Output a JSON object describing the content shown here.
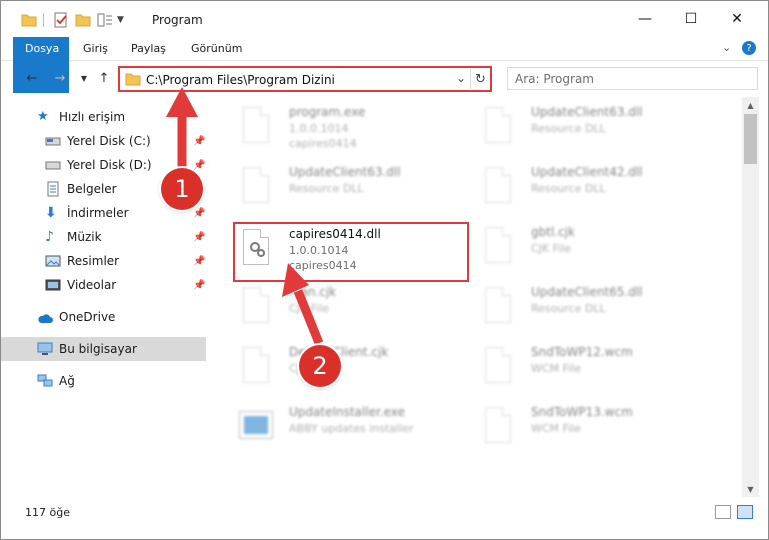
{
  "window": {
    "title": "Program",
    "buttons": {
      "minimize": "—",
      "maximize": "☐",
      "close": "✕"
    }
  },
  "ribbon": {
    "tabs": [
      "Dosya",
      "Giriş",
      "Paylaş",
      "Görünüm"
    ]
  },
  "address": {
    "path": "C:\\Program Files\\Program Dizini",
    "search_placeholder": "Ara: Program"
  },
  "nav_pane": {
    "items": [
      {
        "label": "Hızlı erişim",
        "icon": "star-icon",
        "pinned": false
      },
      {
        "label": "Yerel Disk (C:)",
        "icon": "drive-icon",
        "pinned": true
      },
      {
        "label": "Yerel Disk (D:)",
        "icon": "drive-icon",
        "pinned": true
      },
      {
        "label": "Belgeler",
        "icon": "documents-icon",
        "pinned": true
      },
      {
        "label": "İndirmeler",
        "icon": "download-icon",
        "pinned": true
      },
      {
        "label": "Müzik",
        "icon": "music-icon",
        "pinned": true
      },
      {
        "label": "Resimler",
        "icon": "pictures-icon",
        "pinned": true
      },
      {
        "label": "Videolar",
        "icon": "videos-icon",
        "pinned": true
      },
      {
        "label": "OneDrive",
        "icon": "cloud-icon",
        "pinned": false
      },
      {
        "label": "Bu bilgisayar",
        "icon": "computer-icon",
        "pinned": false,
        "selected": true
      },
      {
        "label": "Ağ",
        "icon": "network-icon",
        "pinned": false
      }
    ]
  },
  "files": [
    {
      "name": "program.exe",
      "line1": "1.0.0.1014",
      "line2": "capires0414",
      "icon": "exe-icon"
    },
    {
      "name": "UpdateClient63.dll",
      "line1": "Resource DLL",
      "line2": "",
      "icon": "dll-icon"
    },
    {
      "name": "UpdateClient63.dll",
      "line1": "Resource DLL",
      "line2": "",
      "icon": "dll-icon"
    },
    {
      "name": "UpdateClient42.dll",
      "line1": "Resource DLL",
      "line2": "",
      "icon": "dll-icon"
    },
    {
      "name": "capires0414.dll",
      "line1": "1.0.0.1014",
      "line2": "capires0414",
      "icon": "dll-icon",
      "highlighted": true
    },
    {
      "name": "gbtl.cjk",
      "line1": "CJK File",
      "line2": "",
      "icon": "file-icon"
    },
    {
      "name": "...an.cjk",
      "line1": "CJK File",
      "line2": "",
      "icon": "file-icon"
    },
    {
      "name": "UpdateClient65.dll",
      "line1": "Resource DLL",
      "line2": "",
      "icon": "dll-icon"
    },
    {
      "name": "DefaultClient.cjk",
      "line1": "CJK File",
      "line2": "",
      "icon": "file-icon"
    },
    {
      "name": "SndToWP12.wcm",
      "line1": "WCM File",
      "line2": "",
      "icon": "file-icon"
    },
    {
      "name": "UpdateInstaller.exe",
      "line1": "ABBY updates installer",
      "line2": "",
      "icon": "installer-icon"
    },
    {
      "name": "SndToWP13.wcm",
      "line1": "WCM File",
      "line2": "",
      "icon": "file-icon"
    }
  ],
  "status": {
    "count": "117 öğe"
  },
  "annotations": {
    "badge1": "1",
    "badge2": "2",
    "accent": "#e03a3a"
  }
}
